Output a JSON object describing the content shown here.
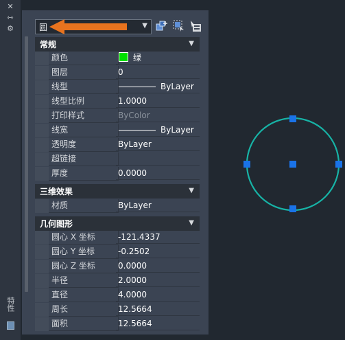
{
  "strip": {
    "close_icon": "close-icon",
    "autohide_icon": "autohide-icon",
    "settings_icon": "gear-icon",
    "title": "特性"
  },
  "header": {
    "selector_value": "圆",
    "buttons": [
      "quick-select-icon",
      "select-objects-icon",
      "toggle-pickadd-icon"
    ]
  },
  "sections": {
    "general": {
      "title": "常规",
      "rows": {
        "color": {
          "label": "颜色",
          "value": "绿",
          "swatch": "#00e000"
        },
        "layer": {
          "label": "图层",
          "value": "0"
        },
        "linetype": {
          "label": "线型",
          "value": "ByLayer"
        },
        "linetype_scale": {
          "label": "线型比例",
          "value": "1.0000"
        },
        "plot_style": {
          "label": "打印样式",
          "value": "ByColor"
        },
        "lineweight": {
          "label": "线宽",
          "value": "ByLayer"
        },
        "transparency": {
          "label": "透明度",
          "value": "ByLayer"
        },
        "hyperlink": {
          "label": "超链接",
          "value": ""
        },
        "thickness": {
          "label": "厚度",
          "value": "0.0000"
        }
      }
    },
    "3d": {
      "title": "三维效果",
      "rows": {
        "material": {
          "label": "材质",
          "value": "ByLayer"
        }
      }
    },
    "geometry": {
      "title": "几何图形",
      "rows": {
        "center_x": {
          "label": "圆心 X 坐标",
          "value": "-121.4337"
        },
        "center_y": {
          "label": "圆心 Y 坐标",
          "value": "-0.2502"
        },
        "center_z": {
          "label": "圆心 Z 坐标",
          "value": "0.0000"
        },
        "radius": {
          "label": "半径",
          "value": "2.0000"
        },
        "diameter": {
          "label": "直径",
          "value": "4.0000"
        },
        "circumference": {
          "label": "周长",
          "value": "12.5664"
        },
        "area": {
          "label": "面积",
          "value": "12.5664"
        }
      }
    }
  },
  "colors": {
    "accent_arrow": "#e8731e",
    "circle_stroke": "#17b3a6",
    "grip": "#1a73e8"
  }
}
